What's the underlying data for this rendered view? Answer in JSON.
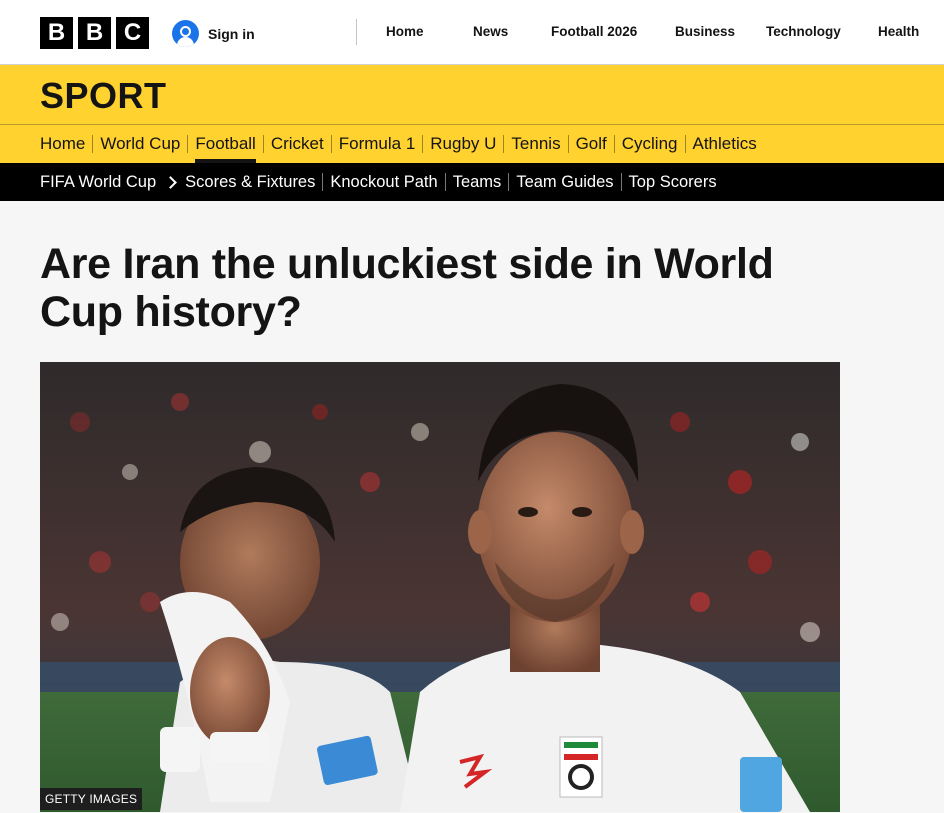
{
  "brand": {
    "letters": [
      "B",
      "B",
      "C"
    ]
  },
  "account": {
    "sign_in_label": "Sign in"
  },
  "top_nav": [
    {
      "label": "Home"
    },
    {
      "label": "News"
    },
    {
      "label": "Football 2026"
    },
    {
      "label": "Business"
    },
    {
      "label": "Technology"
    },
    {
      "label": "Health"
    }
  ],
  "section": {
    "title": "SPORT"
  },
  "sport_nav": [
    {
      "label": "Home"
    },
    {
      "label": "World Cup"
    },
    {
      "label": "Football",
      "active": true
    },
    {
      "label": "Cricket"
    },
    {
      "label": "Formula 1"
    },
    {
      "label": "Rugby U"
    },
    {
      "label": "Tennis"
    },
    {
      "label": "Golf"
    },
    {
      "label": "Cycling"
    },
    {
      "label": "Athletics"
    }
  ],
  "sub_nav": {
    "parent": "FIFA World Cup",
    "items": [
      {
        "label": "Scores & Fixtures"
      },
      {
        "label": "Knockout Path"
      },
      {
        "label": "Teams"
      },
      {
        "label": "Team Guides"
      },
      {
        "label": "Top Scorers"
      }
    ]
  },
  "article": {
    "headline": "Are Iran the unluckiest side in World Cup history?",
    "image_credit": "GETTY IMAGES"
  },
  "colors": {
    "sport_yellow": "#ffd230",
    "sign_in_blue": "#1a73e8",
    "subnav_black": "#000000"
  }
}
